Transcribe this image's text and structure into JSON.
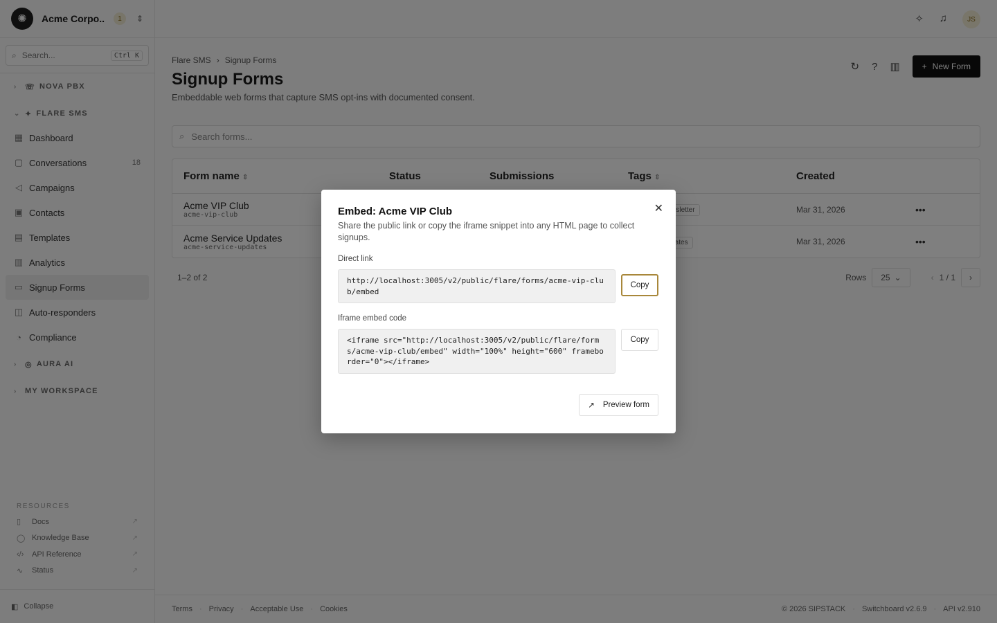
{
  "org": {
    "name": "Acme Corpo...",
    "badge": "1"
  },
  "sidebar": {
    "search_placeholder": "Search...",
    "search_kbd": "Ctrl K",
    "groups": [
      {
        "label": "NOVA PBX"
      },
      {
        "label": "FLARE SMS"
      },
      {
        "label": "AURA AI"
      },
      {
        "label": "MY WORKSPACE"
      }
    ],
    "items": [
      {
        "label": "Dashboard"
      },
      {
        "label": "Conversations",
        "count": "18"
      },
      {
        "label": "Campaigns"
      },
      {
        "label": "Contacts"
      },
      {
        "label": "Templates"
      },
      {
        "label": "Analytics"
      },
      {
        "label": "Signup Forms"
      },
      {
        "label": "Auto-responders"
      },
      {
        "label": "Compliance"
      }
    ],
    "resources_title": "RESOURCES",
    "resources": [
      {
        "label": "Docs"
      },
      {
        "label": "Knowledge Base"
      },
      {
        "label": "API Reference"
      },
      {
        "label": "Status"
      }
    ],
    "collapse_label": "Collapse"
  },
  "topbar": {
    "avatar": "JS"
  },
  "main": {
    "breadcrumb": [
      "Flare SMS",
      "Signup Forms"
    ],
    "title": "Signup Forms",
    "subtitle": "Embeddable web forms that capture SMS opt-ins with documented consent.",
    "new_button": "New Form",
    "search_placeholder": "Search forms...",
    "columns": [
      "Form name",
      "Status",
      "Submissions",
      "Tags",
      "Created"
    ],
    "rows": [
      {
        "name": "Acme VIP Club",
        "slug": "acme-vip-club",
        "tag": "newsletter",
        "created": "Mar 31, 2026"
      },
      {
        "name": "Acme Service Updates",
        "slug": "acme-service-updates",
        "tag": "updates",
        "created": "Mar 31, 2026"
      }
    ],
    "range": "1–2 of 2",
    "rows_label": "Rows",
    "rows_value": "25",
    "page": "1 / 1"
  },
  "footer": {
    "links": [
      "Terms",
      "Privacy",
      "Acceptable Use",
      "Cookies"
    ],
    "copyright": "© 2026 SIPSTACK",
    "version": "Switchboard v2.6.9",
    "api": "API v2.910"
  },
  "modal": {
    "title": "Embed: Acme VIP Club",
    "description": "Share the public link or copy the iframe snippet into any HTML page to collect signups.",
    "direct_label": "Direct link",
    "direct_value": "http://localhost:3005/v2/public/flare/forms/acme-vip-club/embed",
    "iframe_label": "Iframe embed code",
    "iframe_value": "<iframe src=\"http://localhost:3005/v2/public/flare/forms/acme-vip-club/embed\" width=\"100%\" height=\"600\" frameborder=\"0\"></iframe>",
    "copy_label": "Copy",
    "preview_label": "Preview form"
  }
}
